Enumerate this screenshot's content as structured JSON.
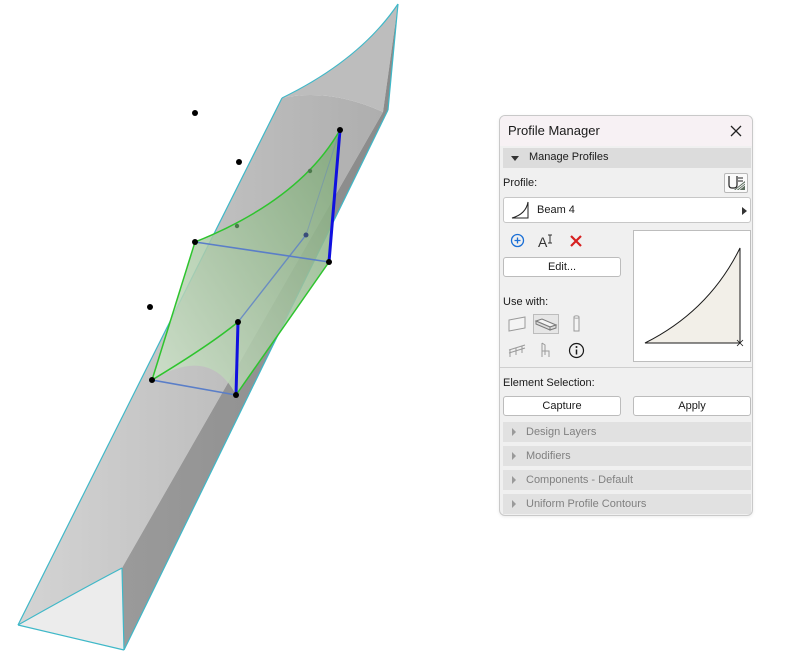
{
  "panel": {
    "title": "Profile Manager",
    "manage_section": "Manage Profiles",
    "profile_label": "Profile:",
    "profile_value": "Beam 4",
    "edit_button": "Edit...",
    "use_with_label": "Use with:",
    "element_selection_label": "Element Selection:",
    "capture_button": "Capture",
    "apply_button": "Apply",
    "collapsed_sections": [
      "Design Layers",
      "Modifiers",
      "Components - Default",
      "Uniform Profile Contours"
    ]
  },
  "icons": {
    "close": "close-icon",
    "profile_tool": "profile-tool-icon",
    "beam_profile": "profile-shape-icon",
    "add": "add-icon",
    "rename": "rename-icon",
    "delete": "delete-icon",
    "wall": "wall-icon",
    "beam": "beam-icon",
    "column": "column-icon",
    "railing": "railing-icon",
    "object": "object-icon",
    "info": "info-icon"
  },
  "colors": {
    "accent_blue": "#1a6fd6",
    "delete_red": "#d62020",
    "highlight_green": "#2ec42e",
    "edge_cyan": "#3fb8c8"
  }
}
